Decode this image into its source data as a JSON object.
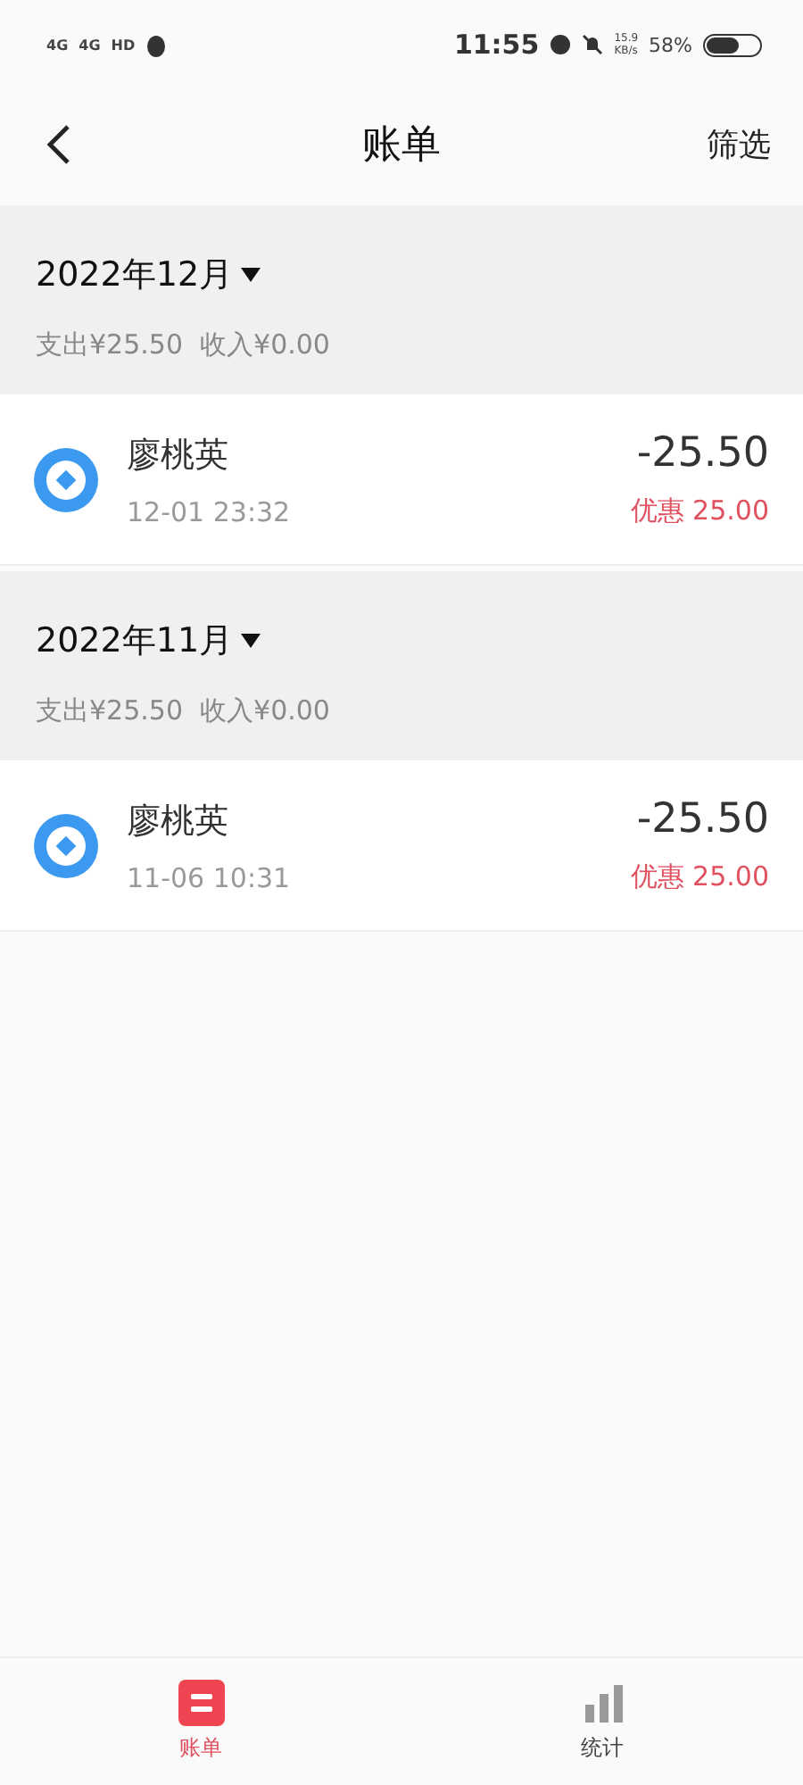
{
  "status_bar": {
    "network_1": "4G",
    "network_2": "4G",
    "hd": "HD",
    "time": "11:55",
    "speed": "15.9",
    "speed_unit": "KB/s",
    "battery": "58%"
  },
  "header": {
    "title": "账单",
    "action": "筛选"
  },
  "months": [
    {
      "month": "2022年12月",
      "summary": "支出¥25.50  收入¥0.00",
      "expanded": true,
      "records": [
        {
          "name": "廖桃英",
          "time": "12-01 23:32",
          "amount": "-25.50",
          "discount": "优惠 25.00"
        }
      ]
    },
    {
      "month": "2022年11月",
      "summary": "支出¥25.50  收入¥0.00",
      "expanded": true,
      "records": [
        {
          "name": "廖桃英",
          "time": "11-06 10:31",
          "amount": "-25.50",
          "discount": "优惠 25.00"
        }
      ]
    }
  ],
  "tab_bar": [
    {
      "label": "账单",
      "selected": true
    },
    {
      "label": "统计",
      "selected": false
    }
  ]
}
